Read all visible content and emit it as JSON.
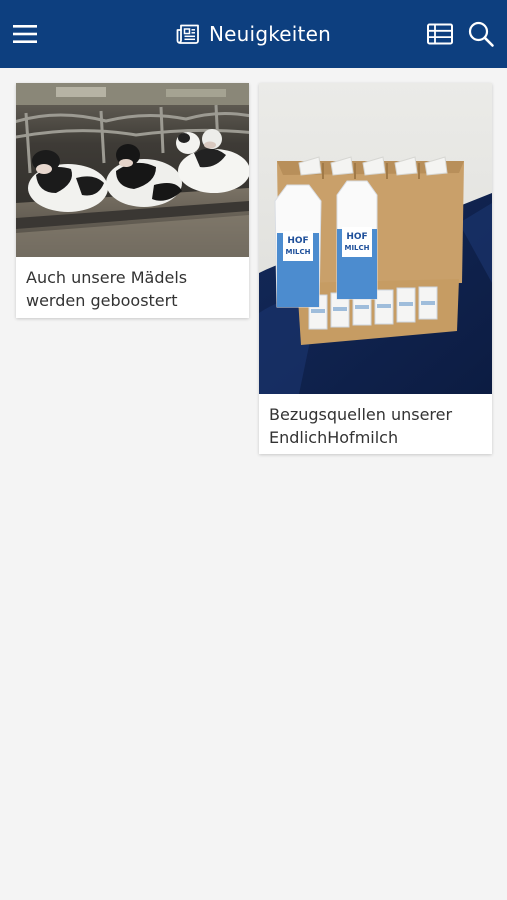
{
  "header": {
    "title": "Neuigkeiten",
    "background": "#0d3f7f",
    "icons": {
      "menu": "hamburger-menu-icon",
      "title": "newspaper-icon",
      "list": "list-view-icon",
      "search": "search-icon"
    }
  },
  "news": {
    "items": [
      {
        "title": "Auch unsere Mädels werden geboostert",
        "image": "cows-in-barn-photo"
      },
      {
        "title": "Bezugsquellen unserer EndlichHofmilch",
        "image": "milk-cartons-photo"
      }
    ]
  },
  "milk": {
    "brand_line1": "HOF",
    "brand_line2": "MILCH"
  }
}
